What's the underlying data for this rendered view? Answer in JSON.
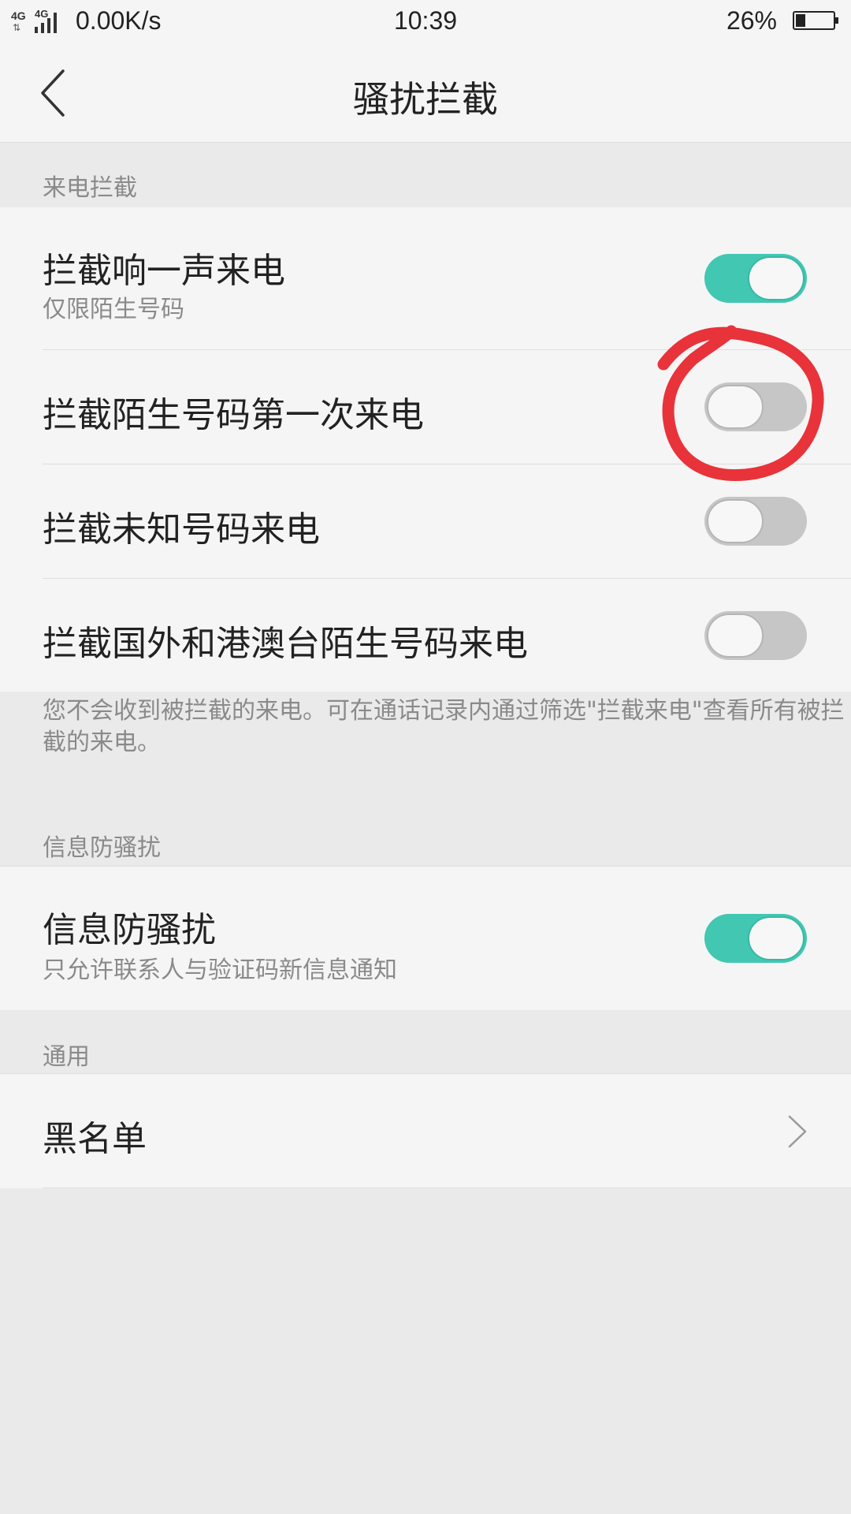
{
  "status_bar": {
    "network_1": "4G",
    "network_2": "4G",
    "speed": "0.00K/s",
    "time": "10:39",
    "battery": "26%",
    "battery_level": 0.26,
    "icons": [
      "signal-icon",
      "battery-icon"
    ]
  },
  "header": {
    "title": "骚扰拦截",
    "back_icon": "back-arrow-icon"
  },
  "sections": {
    "calls": {
      "label": "来电拦截",
      "items": [
        {
          "title": "拦截响一声来电",
          "subtitle": "仅限陌生号码",
          "enabled": true
        },
        {
          "title": "拦截陌生号码第一次来电",
          "enabled": false
        },
        {
          "title": "拦截未知号码来电",
          "enabled": false
        },
        {
          "title": "拦截国外和港澳台陌生号码来电",
          "enabled": false
        }
      ],
      "note": "您不会收到被拦截的来电。可在通话记录内通过筛选\"拦截来电\"查看所有被拦截的来电。"
    },
    "messages": {
      "label": "信息防骚扰",
      "items": [
        {
          "title": "信息防骚扰",
          "subtitle": "只允许联系人与验证码新信息通知",
          "enabled": true
        }
      ]
    },
    "general": {
      "label": "通用",
      "items": [
        {
          "title": "黑名单",
          "icon": "chevron-right-icon"
        }
      ]
    }
  },
  "colors": {
    "toggle_on": "#41c7b2",
    "toggle_off": "#c6c6c6",
    "annotation": "#e8333a"
  }
}
